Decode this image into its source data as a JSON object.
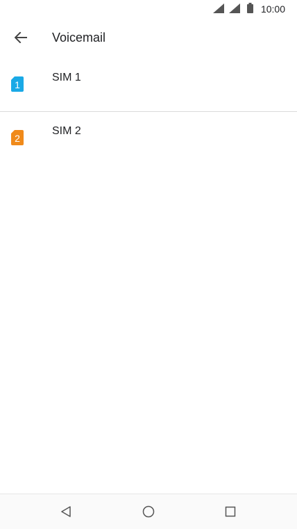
{
  "status_bar": {
    "time": "10:00",
    "icons": [
      "signal-icon",
      "signal-icon",
      "battery-icon"
    ]
  },
  "app_bar": {
    "back_icon": "arrow-back-icon",
    "title": "Voicemail"
  },
  "sim_list": [
    {
      "icon_number": "1",
      "label": "SIM 1",
      "color": "#1aa9e6"
    },
    {
      "icon_number": "2",
      "label": "SIM 2",
      "color": "#f08a1a"
    }
  ],
  "nav_bar": {
    "icons": [
      "nav-back-icon",
      "nav-home-icon",
      "nav-recents-icon"
    ]
  }
}
